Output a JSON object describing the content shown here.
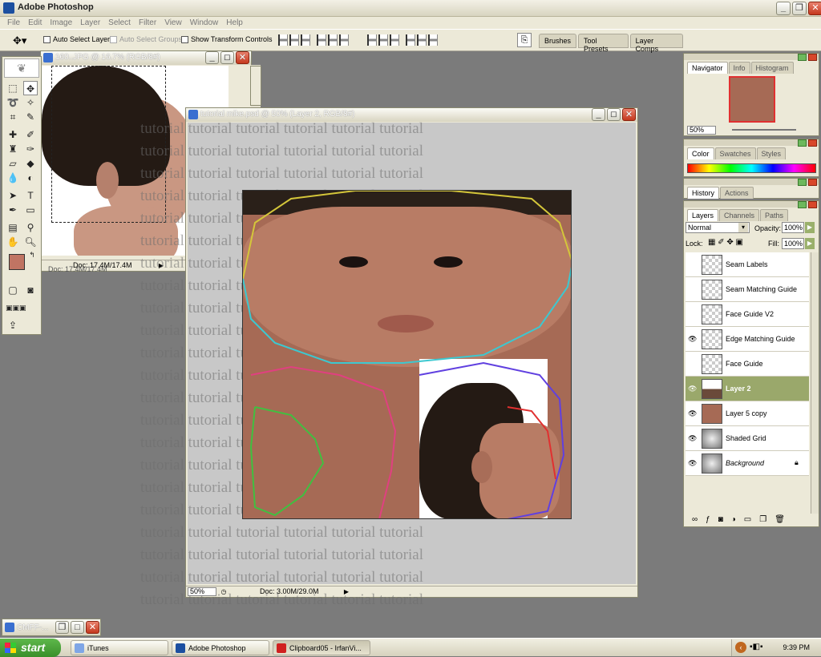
{
  "app": {
    "title": "Adobe Photoshop"
  },
  "menu": [
    "File",
    "Edit",
    "Image",
    "Layer",
    "Select",
    "Filter",
    "View",
    "Window",
    "Help"
  ],
  "options": {
    "auto_select_layer": "Auto Select Layer",
    "auto_select_groups": "Auto Select Groups",
    "show_transform_controls": "Show Transform Controls",
    "palette_well": [
      "Brushes",
      "Tool Presets",
      "Layer Comps"
    ]
  },
  "side_window": {
    "title": "160..JPG @ 16.7% (RGB/8#)",
    "doc": "Doc: 17.4M/17.4M",
    "doc_behind": "Doc: 17.4M/17.4M"
  },
  "main_window": {
    "title": "tutorial mike.psd @ 50% (Layer 2, RGB/8#)",
    "zoom": "50%",
    "doc": "Doc: 3.00M/29.0M",
    "watermark_word": "tutorial"
  },
  "navigator": {
    "tabs": [
      "Navigator",
      "Info",
      "Histogram"
    ],
    "zoom": "50%"
  },
  "color": {
    "tabs": [
      "Color",
      "Swatches",
      "Styles"
    ]
  },
  "history": {
    "tabs": [
      "History",
      "Actions"
    ]
  },
  "layers": {
    "tabs": [
      "Layers",
      "Channels",
      "Paths"
    ],
    "blend_mode": "Normal",
    "opacity_label": "Opacity:",
    "opacity": "100%",
    "lock_label": "Lock:",
    "fill_label": "Fill:",
    "fill": "100%",
    "items": [
      {
        "name": "Seam Labels",
        "visible": false
      },
      {
        "name": "Seam Matching Guide",
        "visible": false
      },
      {
        "name": "Face Guide V2",
        "visible": false
      },
      {
        "name": "Edge Matching Guide",
        "visible": true
      },
      {
        "name": "Face Guide",
        "visible": false
      },
      {
        "name": "Layer 2",
        "visible": true,
        "selected": true
      },
      {
        "name": "Layer 5 copy",
        "visible": true
      },
      {
        "name": "Shaded Grid",
        "visible": true
      },
      {
        "name": "Background",
        "visible": true,
        "locked": true
      }
    ]
  },
  "minimized": {
    "title": "CMFF-..."
  },
  "taskbar": {
    "start": "start",
    "items": [
      "iTunes",
      "Adobe Photoshop",
      "Clipboard05 - IrfanVi..."
    ],
    "clock": "9:39 PM"
  },
  "colors": {
    "xp_blue": "#1c4fa0",
    "selected_layer": "#9aa86b",
    "skin": "#a66a55"
  }
}
